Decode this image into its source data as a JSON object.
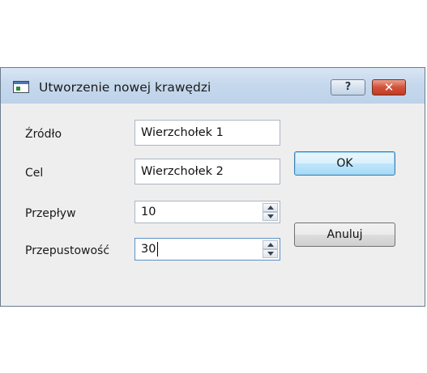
{
  "window": {
    "title": "Utworzenie nowej krawędzi",
    "help_glyph": "?",
    "close_glyph": "✕"
  },
  "form": {
    "source_label": "Źródło",
    "source_value": "Wierzchołek 1",
    "target_label": "Cel",
    "target_value": "Wierzchołek 2",
    "flow_label": "Przepływ",
    "flow_value": "10",
    "capacity_label": "Przepustowość",
    "capacity_value": "30"
  },
  "buttons": {
    "ok_label": "OK",
    "cancel_label": "Anuluj"
  },
  "colors": {
    "titlebar": "#c6d8ec",
    "client_bg": "#eeeeee",
    "default_button": "#bee6fd",
    "close_button": "#c13b22"
  },
  "icons": {
    "app": "window-app-icon",
    "help": "help-icon",
    "close": "close-icon",
    "spin_up": "arrow-up-icon",
    "spin_down": "arrow-down-icon"
  }
}
